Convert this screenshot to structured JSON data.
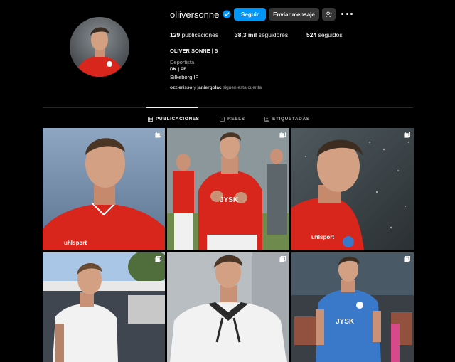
{
  "profile": {
    "username": "oliiversonne",
    "verified": true,
    "follow_label": "Seguir",
    "message_label": "Enviar mensaje",
    "posts_count": "129",
    "posts_label": "publicaciones",
    "followers_count": "38,3 mil",
    "followers_label": "seguidores",
    "following_count": "524",
    "following_label": "seguidos",
    "full_name": "OLIVER SONNE | 5",
    "category": "Deportista",
    "bio_flags": "DK | PE",
    "bio_club": "Silkeborg IF",
    "followed_by_user1": "ozzierisso",
    "followed_by_sep": "y",
    "followed_by_user2": "janiergolac",
    "followed_by_suffix": "siguen esta cuenta"
  },
  "tabs": [
    {
      "label": "PUBLICACIONES",
      "icon": "grid-icon",
      "active": true
    },
    {
      "label": "REELS",
      "icon": "reels-icon",
      "active": false
    },
    {
      "label": "ETIQUETADAS",
      "icon": "tagged-icon",
      "active": false
    }
  ],
  "posts": [
    {
      "subject": "portrait-red-kit",
      "multi": true,
      "print": "uhlsport"
    },
    {
      "subject": "clapping-red-kit",
      "multi": true,
      "print": "JYSK"
    },
    {
      "subject": "rain-red-kit",
      "multi": true,
      "print": "uhlsport"
    },
    {
      "subject": "white-tee-stadium",
      "multi": true,
      "print": ""
    },
    {
      "subject": "white-tee-scarf",
      "multi": true,
      "print": ""
    },
    {
      "subject": "blue-kit-match",
      "multi": true,
      "print": "JYSK"
    }
  ],
  "colors": {
    "accent": "#0095f6",
    "button_secondary": "#363636",
    "kit_red": "#d9261c",
    "kit_blue": "#3a78c9"
  }
}
